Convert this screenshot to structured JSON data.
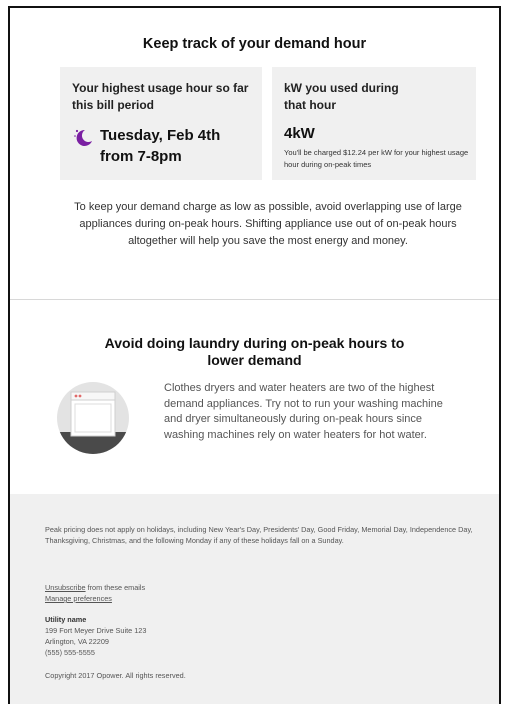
{
  "demand": {
    "heading": "Keep track of your demand hour",
    "left_card": {
      "title": "Your highest usage hour so far this bill period",
      "date_line1": "Tuesday, Feb 4th",
      "date_line2": "from 7-8pm",
      "icon": "moon-icon"
    },
    "right_card": {
      "title": "kW you used during that hour",
      "value": "4kW",
      "note": "You'll be charged $12.24 per kW for your highest usage hour during on-peak times"
    },
    "paragraph": "To keep your demand charge as low as possible, avoid overlapping use of large appliances during on-peak hours. Shifting appliance use out of on-peak hours altogether will help you save the most energy and money."
  },
  "laundry": {
    "heading": "Avoid doing laundry during on-peak hours to lower demand",
    "icon": "washing-machine-icon",
    "paragraph": "Clothes dryers and water heaters are two of the highest demand appliances. Try not to run your washing machine and dryer simultaneously during on-peak hours since washing machines rely on water heaters for hot water."
  },
  "footer": {
    "disclaimer": "Peak pricing does not apply on holidays, including New Year's Day, Presidents' Day, Good Friday, Memorial Day, Independence Day, Thanksgiving, Christmas, and the following Monday if any of these holidays fall on a Sunday.",
    "unsubscribe_link": "Unsubscribe",
    "unsubscribe_suffix": " from these emails",
    "manage_link": "Manage preferences",
    "utility_name": "Utility name",
    "address_line1": "199 Fort Meyer Drive Suite 123",
    "address_line2": "Arlington, VA 22209",
    "phone": "(555) 555-5555",
    "copyright": "Copyright 2017 Opower. All rights reserved."
  },
  "colors": {
    "accent_purple": "#7a1fa2",
    "card_bg": "#f0f0f0",
    "footer_bg": "#f0f0f0"
  }
}
